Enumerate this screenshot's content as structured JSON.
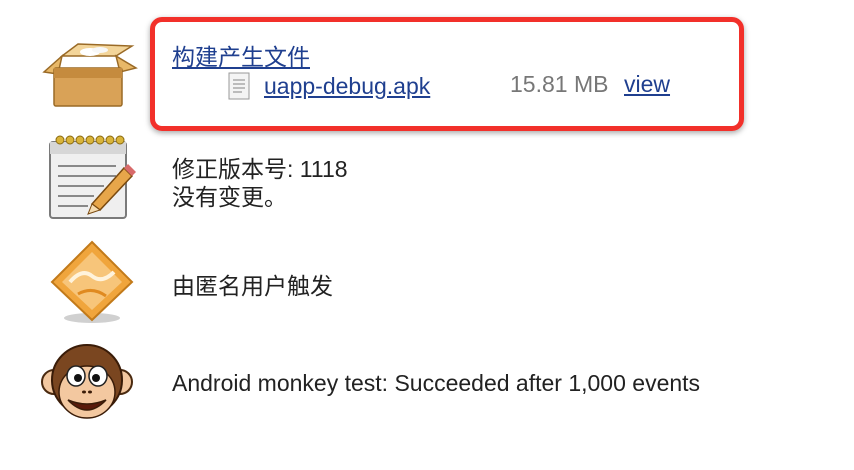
{
  "artifacts": {
    "title": "构建产生文件",
    "file": {
      "name": "uapp-debug.apk",
      "size": "15.81 MB",
      "view_label": "view"
    }
  },
  "changes": {
    "revision_line": "修正版本号: 1118",
    "no_changes": "没有变更。"
  },
  "cause": {
    "text": "由匿名用户触发"
  },
  "monkey": {
    "text": "Android monkey test: Succeeded after 1,000 events"
  },
  "icons": [
    "package-icon",
    "notepad-icon",
    "user-trigger-icon",
    "monkey-icon",
    "document-icon"
  ],
  "colors": {
    "highlight": "#f2302a",
    "link": "#1f3f8f"
  }
}
